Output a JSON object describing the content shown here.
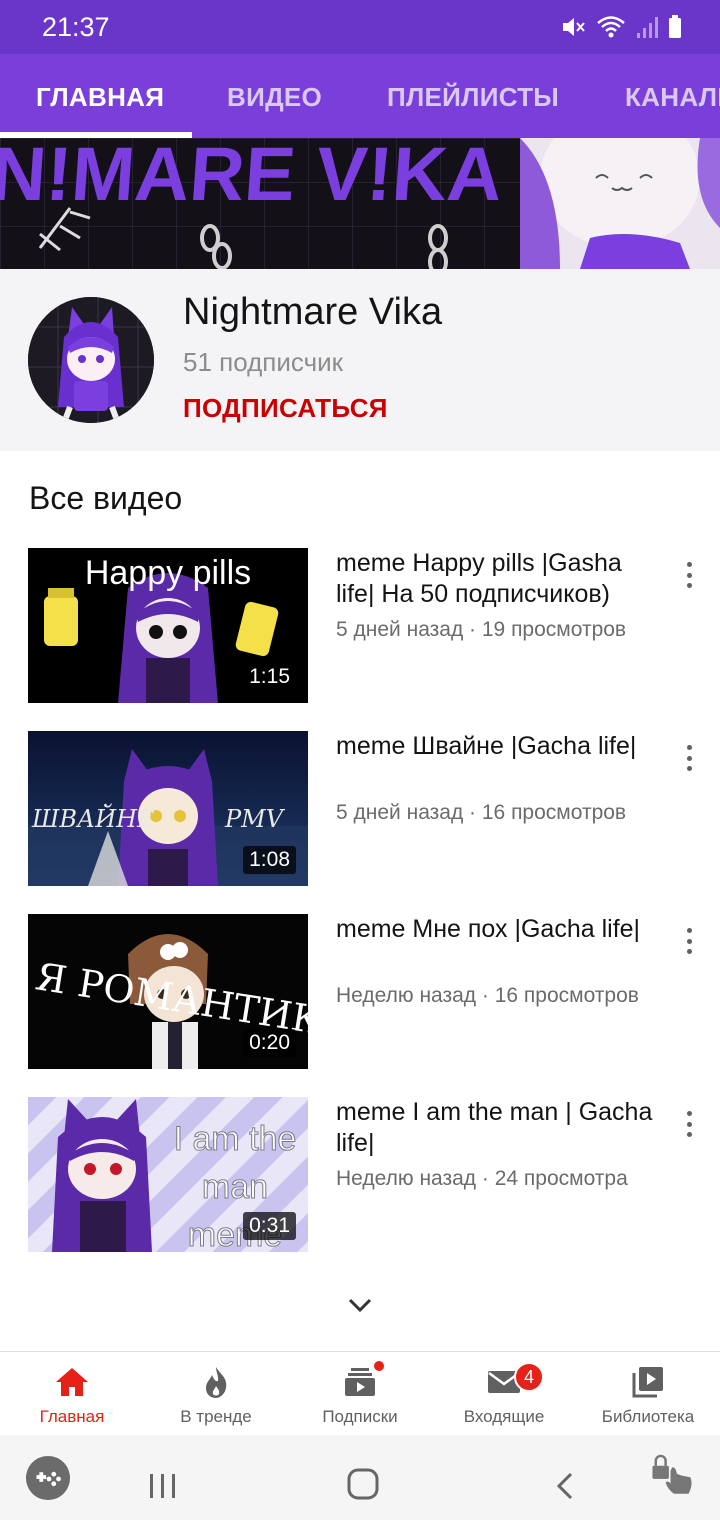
{
  "status_bar": {
    "time": "21:37"
  },
  "tabs": [
    {
      "label": "ГЛАВНАЯ",
      "active": true
    },
    {
      "label": "ВИДЕО",
      "active": false
    },
    {
      "label": "ПЛЕЙЛИСТЫ",
      "active": false
    },
    {
      "label": "КАНАЛЫ",
      "active": false
    }
  ],
  "banner": {
    "text": "N!MARE V!KA"
  },
  "channel": {
    "name": "Nightmare Vika",
    "subscribers": "51 подписчик",
    "subscribe_label": "ПОДПИСАТЬСЯ"
  },
  "section_title": "Все видео",
  "videos": [
    {
      "title": "meme Happy pills |Gasha life| На 50 подписчиков)",
      "meta": "5 дней назад · 19 просмотров",
      "duration": "1:15",
      "thumb_text": "Happy pills"
    },
    {
      "title": "meme Швайне |Gacha life|",
      "meta": "5 дней назад · 16 просмотров",
      "duration": "1:08",
      "thumb_text_left": "ШВАЙНЕ",
      "thumb_text_right": "PMV"
    },
    {
      "title": "meme Мне пох |Gacha life|",
      "meta": "Неделю назад · 16 просмотров",
      "duration": "0:20",
      "thumb_text": "Я РОМАНТИК"
    },
    {
      "title": "meme I am the man | Gacha life|",
      "meta": "Неделю назад · 24 просмотра",
      "duration": "0:31",
      "thumb_text": "I am the man meme"
    }
  ],
  "bottom_nav": [
    {
      "label": "Главная",
      "icon": "home-icon",
      "active": true
    },
    {
      "label": "В тренде",
      "icon": "trending-icon",
      "active": false
    },
    {
      "label": "Подписки",
      "icon": "subscriptions-icon",
      "active": false
    },
    {
      "label": "Входящие",
      "icon": "inbox-icon",
      "active": false,
      "badge": "4"
    },
    {
      "label": "Библиотека",
      "icon": "library-icon",
      "active": false
    }
  ],
  "colors": {
    "accent_purple": "#7a3fdb",
    "status_purple": "#6a36c9",
    "subscribe_red": "#cc0000",
    "active_red": "#e62117"
  }
}
